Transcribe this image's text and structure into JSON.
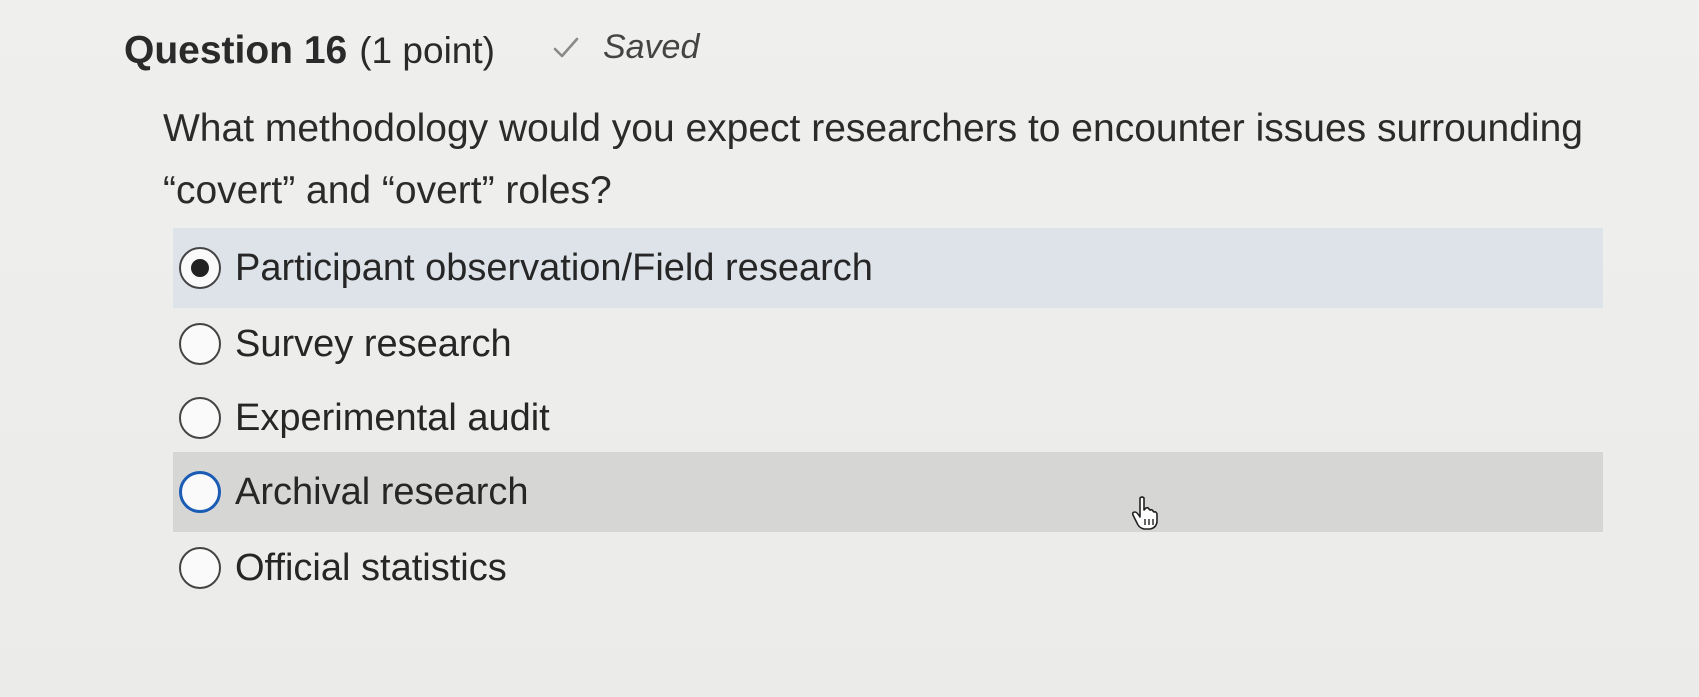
{
  "header": {
    "title": "Question 16",
    "points": "(1 point)",
    "status_icon": "check-icon",
    "status_text": "Saved"
  },
  "question": {
    "text": "What methodology would you expect researchers to encounter issues surrounding “covert” and “overt” roles?"
  },
  "options": [
    {
      "label": "Participant observation/Field research",
      "selected": true
    },
    {
      "label": "Survey research",
      "selected": false
    },
    {
      "label": "Experimental audit",
      "selected": false
    },
    {
      "label": "Archival research",
      "selected": false
    },
    {
      "label": "Official statistics",
      "selected": false
    }
  ],
  "colors": {
    "selected_bg": "#dde3e8",
    "hover_bg": "#d6d6d4",
    "focus_ring": "#1a5bb5"
  }
}
